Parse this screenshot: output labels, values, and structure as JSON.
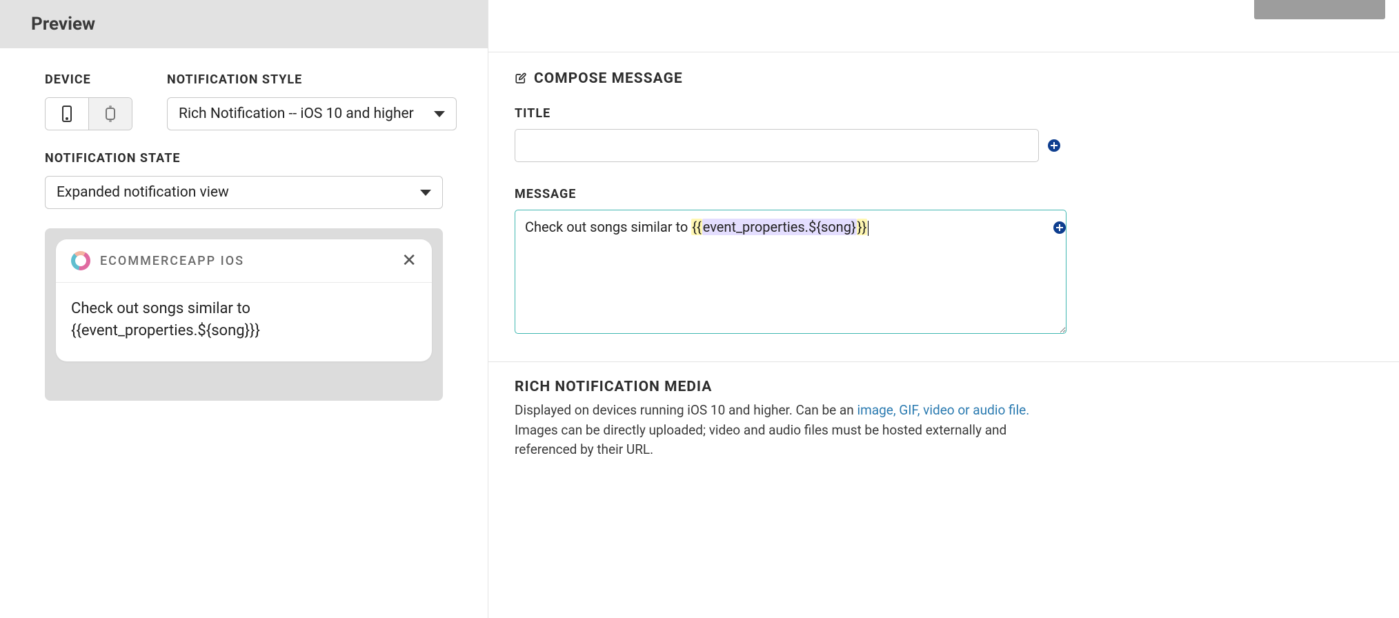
{
  "colors": {
    "accent_teal": "#3FB7B1",
    "plus_blue": "#0E3E8F"
  },
  "preview": {
    "header": "Preview",
    "labels": {
      "device": "DEVICE",
      "notification_style": "NOTIFICATION STYLE",
      "notification_state": "NOTIFICATION STATE"
    },
    "device_options": [
      "phone",
      "watch"
    ],
    "device_selected": "phone",
    "notification_style_selected": "Rich Notification -- iOS 10 and higher",
    "notification_state_selected": "Expanded notification view",
    "sample_notification": {
      "app_name": "ECOMMERCEAPP IOS",
      "close_glyph": "✕",
      "body": "Check out songs similar to {{event_properties.${song}}}"
    }
  },
  "compose": {
    "section_title": "COMPOSE MESSAGE",
    "icon": "edit-icon",
    "title_label": "TITLE",
    "title_value": "",
    "title_placeholder": "",
    "message_label": "MESSAGE",
    "message_prefix": "Check out songs similar to ",
    "message_template_outer_open": "{{",
    "message_template_inner": "event_properties.${song}",
    "message_template_outer_close": "}}",
    "add_icon": "plus-circle-icon"
  },
  "rich_media": {
    "title": "RICH NOTIFICATION MEDIA",
    "desc_before_link": "Displayed on devices running iOS 10 and higher. Can be an ",
    "link_text": "image, GIF, video or audio file.",
    "desc_after_link": " Images can be directly uploaded; video and audio files must be hosted externally and referenced by their URL."
  }
}
